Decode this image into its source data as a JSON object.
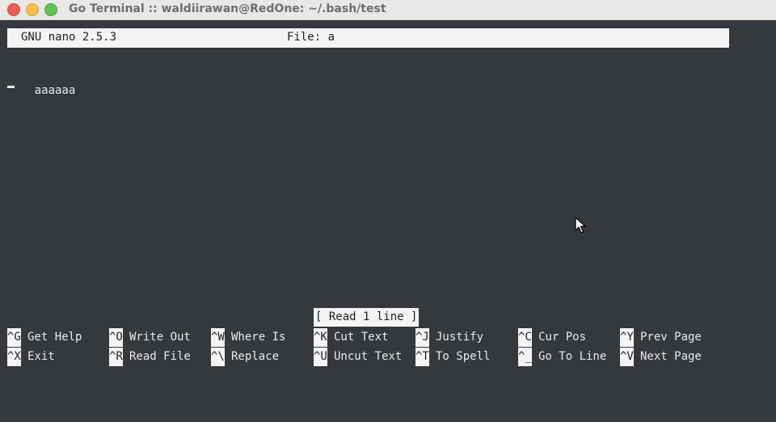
{
  "window": {
    "title": "Go Terminal :: waldiirawan@RedOne: ~/.bash/test"
  },
  "nano": {
    "version": "GNU nano 2.5.3",
    "file_label": "File: a",
    "content": "aaaaaa",
    "status": "[ Read 1 line ]"
  },
  "shortcuts": [
    {
      "key": "^G",
      "label": "Get Help"
    },
    {
      "key": "^O",
      "label": "Write Out"
    },
    {
      "key": "^W",
      "label": "Where Is"
    },
    {
      "key": "^K",
      "label": "Cut Text"
    },
    {
      "key": "^J",
      "label": "Justify"
    },
    {
      "key": "^C",
      "label": "Cur Pos"
    },
    {
      "key": "^Y",
      "label": "Prev Page"
    },
    {
      "key": "^X",
      "label": "Exit"
    },
    {
      "key": "^R",
      "label": "Read File"
    },
    {
      "key": "^\\",
      "label": "Replace"
    },
    {
      "key": "^U",
      "label": "Uncut Text"
    },
    {
      "key": "^T",
      "label": "To Spell"
    },
    {
      "key": "^_",
      "label": "Go To Line"
    },
    {
      "key": "^V",
      "label": "Next Page"
    }
  ],
  "colors": {
    "background": "#35383d",
    "bar": "#f4f4f4",
    "text": "#eaeaea"
  }
}
